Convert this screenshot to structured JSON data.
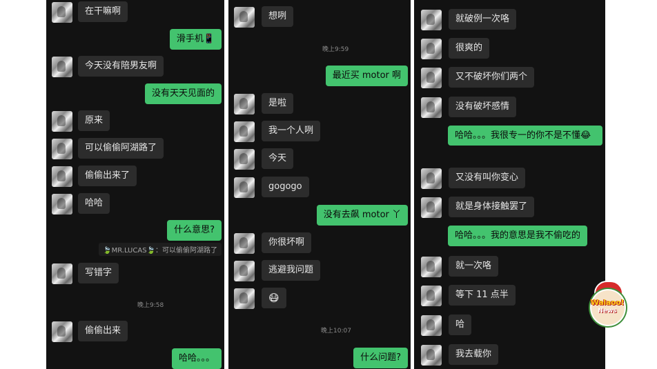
{
  "panel1": {
    "m1": "在干嘛啊",
    "m2": "滑手机📱",
    "m3": "今天没有陪男友啊",
    "m4": "没有天天见面的",
    "m5": "原来",
    "m6": "可以偷偷阿湖路了",
    "m7": "偷偷出来了",
    "m8": "哈哈",
    "m9": "什么意思?",
    "quote": "🍃MR.LUCAS🍃：可以偷偷阿湖路了",
    "m10": "写错字",
    "time1": "晚上9:58",
    "m11": "偷偷出来",
    "m12": "哈哈。。。"
  },
  "panel2": {
    "m1": "想咧",
    "time1": "晚上9:59",
    "m2": "最近买 motor 啊",
    "m3": "是啦",
    "m4": "我一个人咧",
    "m5": "今天",
    "m6": "gogogo",
    "m7": "没有去飙 motor 丫",
    "m8": "你很坏啊",
    "m9": "逃避我问题",
    "m10": "😷",
    "time2": "晚上10:07",
    "m11": "什么问题?"
  },
  "panel3": {
    "m1": "就破例一次咯",
    "m2": "很爽的",
    "m3": "又不破坏你们两个",
    "m4": "没有破坏感情",
    "m5": "哈哈。。。我很专一的你不是不懂😂",
    "m6": "又没有叫你变心",
    "m7": "就是身体接触罢了",
    "m8": "哈哈。。。我的意思是我不偷吃的",
    "m9": "就一次咯",
    "m10": "等下 11 点半",
    "m11": "哈",
    "m12": "我去载你"
  },
  "watermark": {
    "title": "Walaoo!",
    "sub": "News"
  },
  "colors": {
    "outgoing_bubble": "#43c36e",
    "incoming_bubble": "#2c2c2c",
    "background": "#121212"
  }
}
